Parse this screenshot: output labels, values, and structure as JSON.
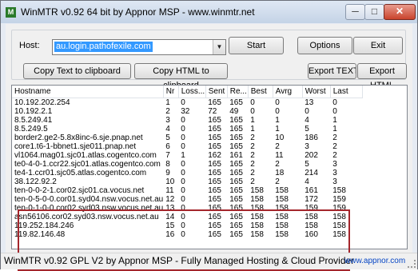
{
  "window": {
    "title": "WinMTR v0.92 64 bit by Appnor MSP - www.winmtr.net",
    "icon": "winmtr-app-icon",
    "controls": {
      "minimize": "─",
      "maximize": "□",
      "close": "✕"
    }
  },
  "host": {
    "label": "Host:",
    "value": "au.login.pathofexile.com",
    "dropdown_icon": "▼"
  },
  "buttons": {
    "start": "Start",
    "options": "Options",
    "exit": "Exit",
    "copy_text": "Copy Text to clipboard",
    "copy_html": "Copy HTML to clipboard",
    "export_text": "Export TEXT",
    "export_html": "Export HTML"
  },
  "table": {
    "columns": [
      "Hostname",
      "Nr",
      "Loss...",
      "Sent",
      "Re...",
      "Best",
      "Avrg",
      "Worst",
      "Last"
    ],
    "rows": [
      [
        "10.192.202.254",
        "1",
        "0",
        "165",
        "165",
        "0",
        "0",
        "13",
        "0"
      ],
      [
        "10.192.2.1",
        "2",
        "32",
        "72",
        "49",
        "0",
        "0",
        "0",
        "0"
      ],
      [
        "8.5.249.41",
        "3",
        "0",
        "165",
        "165",
        "1",
        "1",
        "4",
        "1"
      ],
      [
        "8.5.249.5",
        "4",
        "0",
        "165",
        "165",
        "1",
        "1",
        "5",
        "1"
      ],
      [
        "border2.ge2-5.8x8inc-6.sje.pnap.net",
        "5",
        "0",
        "165",
        "165",
        "2",
        "10",
        "186",
        "2"
      ],
      [
        "core1.t6-1-bbnet1.sje011.pnap.net",
        "6",
        "0",
        "165",
        "165",
        "2",
        "2",
        "3",
        "2"
      ],
      [
        "vl1064.mag01.sjc01.atlas.cogentco.com",
        "7",
        "1",
        "162",
        "161",
        "2",
        "11",
        "202",
        "2"
      ],
      [
        "te0-4-0-1.ccr22.sjc01.atlas.cogentco.com",
        "8",
        "0",
        "165",
        "165",
        "2",
        "2",
        "5",
        "3"
      ],
      [
        "te4-1.ccr01.sjc05.atlas.cogentco.com",
        "9",
        "0",
        "165",
        "165",
        "2",
        "18",
        "214",
        "3"
      ],
      [
        "38.122.92.2",
        "10",
        "0",
        "165",
        "165",
        "2",
        "2",
        "4",
        "3"
      ],
      [
        "ten-0-0-2-1.cor02.sjc01.ca.vocus.net",
        "11",
        "0",
        "165",
        "165",
        "158",
        "158",
        "161",
        "158"
      ],
      [
        "ten-0-5-0-0.cor01.syd04.nsw.vocus.net.au",
        "12",
        "0",
        "165",
        "165",
        "158",
        "158",
        "172",
        "159"
      ],
      [
        "ten-0-1-0-0.cor02.syd03.nsw.vocus.net.au",
        "13",
        "0",
        "165",
        "165",
        "158",
        "158",
        "159",
        "159"
      ],
      [
        "asn56106.cor02.syd03.nsw.vocus.net.au",
        "14",
        "0",
        "165",
        "165",
        "158",
        "158",
        "158",
        "158"
      ],
      [
        "119.252.184.246",
        "15",
        "0",
        "165",
        "165",
        "158",
        "158",
        "158",
        "158"
      ],
      [
        "119.82.146.48",
        "16",
        "0",
        "165",
        "165",
        "158",
        "158",
        "160",
        "158"
      ]
    ]
  },
  "status": {
    "text": "WinMTR v0.92 GPL V2 by Appnor MSP - Fully Managed Hosting & Cloud Provider",
    "link": "www.appnor.com"
  },
  "colors": {
    "highlight_box": "#a4262c",
    "selection": "#3399ff",
    "link": "#0645c4"
  }
}
